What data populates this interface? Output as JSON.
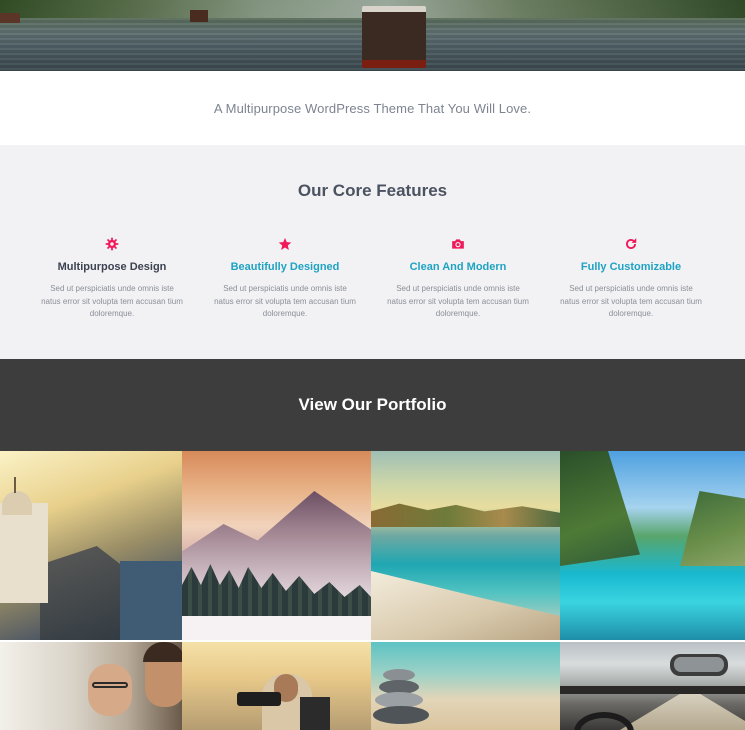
{
  "tagline": "A Multipurpose WordPress Theme That You Will Love.",
  "features": {
    "title": "Our Core Features",
    "items": [
      {
        "icon": "gear-icon",
        "title": "Multipurpose Design",
        "text": "Sed ut perspiciatis unde omnis iste natus error sit volupta tem accusan tium doloremque."
      },
      {
        "icon": "star-icon",
        "title": "Beautifully Designed",
        "text": "Sed ut perspiciatis unde omnis iste natus error sit volupta tem accusan tium doloremque."
      },
      {
        "icon": "camera-icon",
        "title": "Clean And Modern",
        "text": "Sed ut perspiciatis unde omnis iste natus error sit volupta tem accusan tium doloremque."
      },
      {
        "icon": "refresh-icon",
        "title": "Fully Customizable",
        "text": "Sed ut perspiciatis unde omnis iste natus error sit volupta tem accusan tium doloremque."
      }
    ],
    "accent_color": "#f0195a",
    "title_highlight_color": "#1ea3c2"
  },
  "portfolio": {
    "title": "View Our Portfolio"
  }
}
